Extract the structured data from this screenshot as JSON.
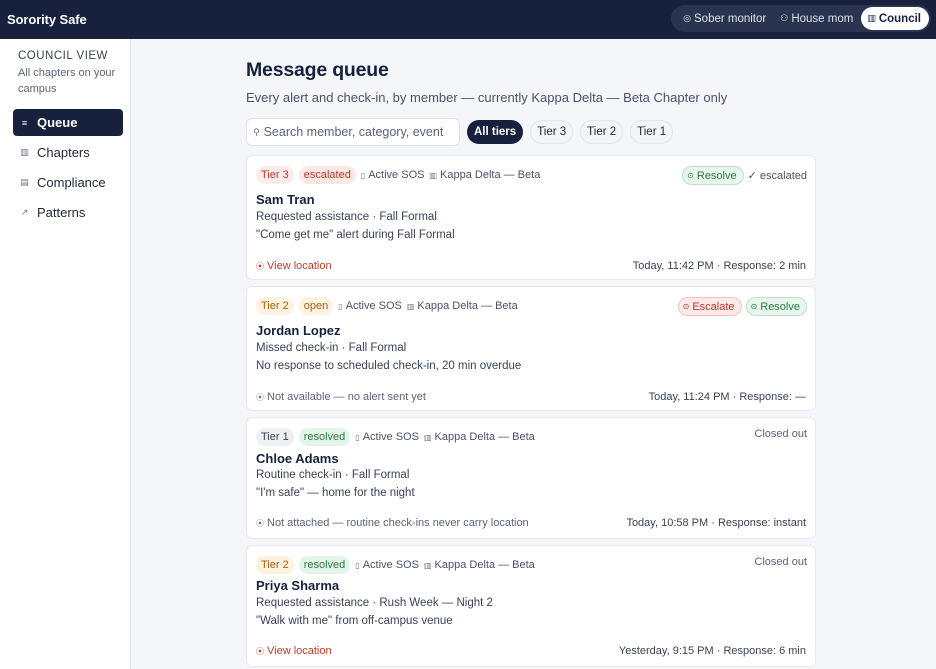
{
  "app": {
    "brand": "Sorority Safe"
  },
  "roles": [
    {
      "label": "Sober monitor",
      "icon": "shield-icon"
    },
    {
      "label": "House mom",
      "icon": "person-icon"
    },
    {
      "label": "Council",
      "icon": "building-icon",
      "active": true
    }
  ],
  "sidebar": {
    "heading": "COUNCIL VIEW",
    "subheading": "All chapters on your campus",
    "items": [
      {
        "label": "Queue",
        "icon": "filter-icon",
        "active": true
      },
      {
        "label": "Chapters",
        "icon": "building-icon"
      },
      {
        "label": "Compliance",
        "icon": "document-icon"
      },
      {
        "label": "Patterns",
        "icon": "trend-icon"
      }
    ]
  },
  "main": {
    "title": "Message queue",
    "subtitle": "Every alert and check-in, by member — currently Kappa Delta — Beta Chapter only",
    "search_placeholder": "Search member, category, event",
    "tiers": [
      "All tiers",
      "Tier 3",
      "Tier 2",
      "Tier 1"
    ]
  },
  "cards": [
    {
      "tier": "Tier 3",
      "status": "escalated",
      "type": "Active SOS",
      "chapter": "Kappa Delta — Beta",
      "name": "Sam Tran",
      "summary": "Requested assistance · Fall Formal",
      "detail": "\"Come get me\" alert during Fall Formal",
      "location": "View location",
      "time": "Today, 11:42 PM · Response: 2 min",
      "resolve_label": "Resolve",
      "state_note": "✓ escalated"
    },
    {
      "tier": "Tier 2",
      "status": "open",
      "type": "Active SOS",
      "chapter": "Kappa Delta — Beta",
      "name": "Jordan Lopez",
      "summary": "Missed check-in · Fall Formal",
      "detail": "No response to scheduled check-in, 20 min overdue",
      "location": "Not available — no alert sent yet",
      "time": "Today, 11:24 PM · Response: —",
      "escalate_label": "Escalate",
      "resolve_label": "Resolve"
    },
    {
      "tier": "Tier 1",
      "status": "resolved",
      "type": "Active SOS",
      "chapter": "Kappa Delta — Beta",
      "name": "Chloe Adams",
      "summary": "Routine check-in · Fall Formal",
      "detail": "\"I'm safe\" — home for the night",
      "location": "Not attached — routine check-ins never carry location",
      "time": "Today, 10:58 PM · Response: instant",
      "closed_note": "Closed out"
    },
    {
      "tier": "Tier 2",
      "status": "resolved",
      "type": "Active SOS",
      "chapter": "Kappa Delta — Beta",
      "name": "Priya Sharma",
      "summary": "Requested assistance · Rush Week — Night 2",
      "detail": "\"Walk with me\" from off-campus venue",
      "location": "View location",
      "time": "Yesterday, 9:15 PM · Response: 6 min",
      "closed_note": "Closed out"
    }
  ]
}
